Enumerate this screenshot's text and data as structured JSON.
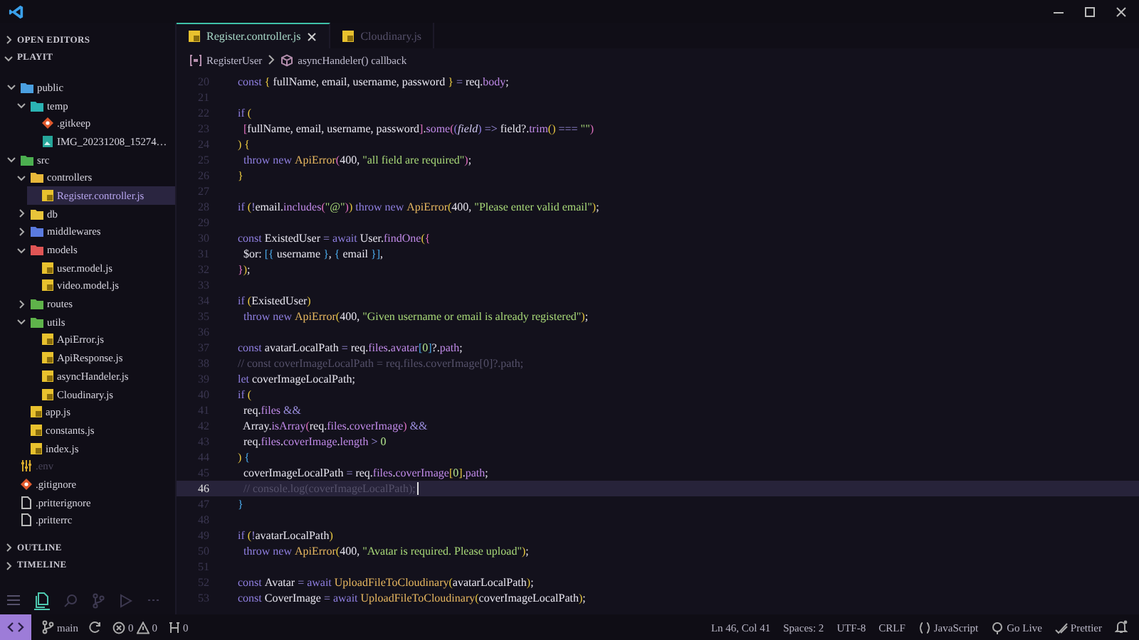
{
  "sidebar": {
    "sections": [
      {
        "label": "OPEN EDITORS",
        "expanded": false
      },
      {
        "label": "PLAYIT",
        "expanded": true
      }
    ],
    "tree": [
      {
        "label": "public",
        "kind": "folder",
        "color": "#4a9fe0",
        "expanded": true,
        "selected": false,
        "children": [
          {
            "label": "temp",
            "kind": "folder",
            "color": "#2bb3b3",
            "expanded": true,
            "selected": false,
            "children": [
              {
                "label": ".gitkeep",
                "kind": "git",
                "selected": false
              },
              {
                "label": "IMG_20231208_15274…",
                "kind": "image",
                "selected": false
              }
            ]
          }
        ]
      },
      {
        "label": "src",
        "kind": "folder",
        "color": "#4caf50",
        "expanded": true,
        "selected": false,
        "children": [
          {
            "label": "controllers",
            "kind": "folder",
            "color": "#e8b83a",
            "expanded": true,
            "selected": false,
            "children": [
              {
                "label": "Register.controller.js",
                "kind": "js",
                "selected": true
              }
            ]
          },
          {
            "label": "db",
            "kind": "folder",
            "color": "#e8c43a",
            "expanded": false,
            "selected": false
          },
          {
            "label": "middlewares",
            "kind": "folder",
            "color": "#5b7be0",
            "expanded": false,
            "selected": false
          },
          {
            "label": "models",
            "kind": "folder",
            "color": "#e05555",
            "expanded": true,
            "selected": false,
            "children": [
              {
                "label": "user.model.js",
                "kind": "js",
                "selected": false
              },
              {
                "label": "video.model.js",
                "kind": "js",
                "selected": false
              }
            ]
          },
          {
            "label": "routes",
            "kind": "folder",
            "color": "#5fb34a",
            "expanded": false,
            "selected": false
          },
          {
            "label": "utils",
            "kind": "folder",
            "color": "#5fb34b",
            "expanded": true,
            "selected": false,
            "children": [
              {
                "label": "ApiError.js",
                "kind": "js",
                "selected": false
              },
              {
                "label": "ApiResponse.js",
                "kind": "js",
                "selected": false
              },
              {
                "label": "asyncHandeler.js",
                "kind": "js",
                "selected": false
              },
              {
                "label": "Cloudinary.js",
                "kind": "js",
                "selected": false
              }
            ]
          },
          {
            "label": "app.js",
            "kind": "js",
            "selected": false
          },
          {
            "label": "constants.js",
            "kind": "js",
            "selected": false
          },
          {
            "label": "index.js",
            "kind": "js",
            "selected": false
          }
        ]
      },
      {
        "label": ".env",
        "kind": "env",
        "selected": false
      },
      {
        "label": ".gitignore",
        "kind": "git",
        "selected": false
      },
      {
        "label": ".pritterignore",
        "kind": "text",
        "selected": false
      },
      {
        "label": ".pritterrc",
        "kind": "text",
        "selected": false
      }
    ],
    "panels": [
      {
        "label": "OUTLINE",
        "expanded": false
      },
      {
        "label": "TIMELINE",
        "expanded": false
      }
    ]
  },
  "tabs": [
    {
      "label": "Register.controller.js",
      "selected": true
    },
    {
      "label": "Cloudinary.js",
      "selected": false
    }
  ],
  "breadcrumb": [
    {
      "label": "RegisterUser",
      "kind": "variable"
    },
    {
      "label": "asyncHandeler() callback",
      "kind": "function"
    }
  ],
  "editor": {
    "lines": [
      {
        "n": "20",
        "current": false,
        "segs": [
          {
            "kind": "kw",
            "text": "const "
          },
          {
            "kind": "br",
            "text": "{ "
          },
          {
            "kind": "id",
            "text": "fullName, email, username, password "
          },
          {
            "kind": "br",
            "text": "}"
          },
          {
            "kind": "op",
            "text": " = "
          },
          {
            "kind": "id",
            "text": "req."
          },
          {
            "kind": "prop",
            "text": "body"
          },
          {
            "kind": "id",
            "text": ";"
          }
        ]
      },
      {
        "n": "21",
        "current": false
      },
      {
        "n": "22",
        "current": false,
        "segs": [
          {
            "kind": "kw",
            "text": "if "
          },
          {
            "kind": "br",
            "text": "("
          }
        ]
      },
      {
        "n": "23",
        "current": false,
        "segs": [
          {
            "kind": "br2",
            "text": "  ["
          },
          {
            "kind": "id",
            "text": "fullName, email, username, password"
          },
          {
            "kind": "br2",
            "text": "]"
          },
          {
            "kind": "id",
            "text": "."
          },
          {
            "kind": "prop",
            "text": "some"
          },
          {
            "kind": "br2",
            "text": "("
          },
          {
            "kind": "kw",
            "text": "("
          },
          {
            "kind": "ital",
            "text": "field"
          },
          {
            "kind": "kw",
            "text": ")"
          },
          {
            "kind": "op",
            "text": " => "
          },
          {
            "kind": "id",
            "text": "field?."
          },
          {
            "kind": "prop",
            "text": "trim"
          },
          {
            "kind": "br",
            "text": "()"
          },
          {
            "kind": "op",
            "text": " === "
          },
          {
            "kind": "str",
            "text": "\"\""
          },
          {
            "kind": "br2",
            "text": ")"
          }
        ]
      },
      {
        "n": "24",
        "current": false,
        "segs": [
          {
            "kind": "br",
            "text": ") {"
          }
        ]
      },
      {
        "n": "25",
        "current": false,
        "segs": [
          {
            "kind": "kw",
            "text": "  throw new "
          },
          {
            "kind": "fn",
            "text": "ApiError"
          },
          {
            "kind": "br2",
            "text": "("
          },
          {
            "kind": "id",
            "text": "400, "
          },
          {
            "kind": "str",
            "text": "\"all field are required\""
          },
          {
            "kind": "br2",
            "text": ")"
          },
          {
            "kind": "id",
            "text": ";"
          }
        ]
      },
      {
        "n": "26",
        "current": false,
        "segs": [
          {
            "kind": "br",
            "text": "}"
          }
        ]
      },
      {
        "n": "27",
        "current": false
      },
      {
        "n": "28",
        "current": false,
        "segs": [
          {
            "kind": "kw",
            "text": "if "
          },
          {
            "kind": "br",
            "text": "("
          },
          {
            "kind": "op",
            "text": "!"
          },
          {
            "kind": "id",
            "text": "email."
          },
          {
            "kind": "prop",
            "text": "includes"
          },
          {
            "kind": "br2",
            "text": "("
          },
          {
            "kind": "str",
            "text": "\"@\""
          },
          {
            "kind": "br2",
            "text": ")"
          },
          {
            "kind": "br",
            "text": ")"
          },
          {
            "kind": "kw",
            "text": " throw new "
          },
          {
            "kind": "fn",
            "text": "ApiError"
          },
          {
            "kind": "br",
            "text": "("
          },
          {
            "kind": "id",
            "text": "400, "
          },
          {
            "kind": "str",
            "text": "\"Please enter valid email\""
          },
          {
            "kind": "br",
            "text": ")"
          },
          {
            "kind": "id",
            "text": ";"
          }
        ]
      },
      {
        "n": "29",
        "current": false
      },
      {
        "n": "30",
        "current": false,
        "segs": [
          {
            "kind": "kw",
            "text": "const "
          },
          {
            "kind": "id",
            "text": "ExistedUser "
          },
          {
            "kind": "op",
            "text": "= "
          },
          {
            "kind": "kw",
            "text": "await "
          },
          {
            "kind": "id",
            "text": "User."
          },
          {
            "kind": "prop",
            "text": "findOne"
          },
          {
            "kind": "br",
            "text": "("
          },
          {
            "kind": "br2",
            "text": "{"
          }
        ]
      },
      {
        "n": "31",
        "current": false,
        "segs": [
          {
            "kind": "id",
            "text": "  $or: "
          },
          {
            "kind": "br3",
            "text": "[{ "
          },
          {
            "kind": "id",
            "text": "username "
          },
          {
            "kind": "br3",
            "text": "}"
          },
          {
            "kind": "id",
            "text": ", "
          },
          {
            "kind": "br3",
            "text": "{ "
          },
          {
            "kind": "id",
            "text": "email "
          },
          {
            "kind": "br3",
            "text": "}]"
          },
          {
            "kind": "id",
            "text": ","
          }
        ]
      },
      {
        "n": "32",
        "current": false,
        "segs": [
          {
            "kind": "br2",
            "text": "}"
          },
          {
            "kind": "br",
            "text": ")"
          },
          {
            "kind": "id",
            "text": ";"
          }
        ]
      },
      {
        "n": "33",
        "current": false
      },
      {
        "n": "34",
        "current": false,
        "segs": [
          {
            "kind": "kw",
            "text": "if "
          },
          {
            "kind": "br",
            "text": "("
          },
          {
            "kind": "id",
            "text": "ExistedUser"
          },
          {
            "kind": "br",
            "text": ")"
          }
        ]
      },
      {
        "n": "35",
        "current": false,
        "segs": [
          {
            "kind": "kw",
            "text": "  throw new "
          },
          {
            "kind": "fn",
            "text": "ApiError"
          },
          {
            "kind": "br",
            "text": "("
          },
          {
            "kind": "id",
            "text": "400, "
          },
          {
            "kind": "str",
            "text": "\"Given username or email is already registered\""
          },
          {
            "kind": "br",
            "text": ")"
          },
          {
            "kind": "id",
            "text": ";"
          }
        ]
      },
      {
        "n": "36",
        "current": false
      },
      {
        "n": "37",
        "current": false,
        "segs": [
          {
            "kind": "kw",
            "text": "const "
          },
          {
            "kind": "id",
            "text": "avatarLocalPath "
          },
          {
            "kind": "op",
            "text": "= "
          },
          {
            "kind": "id",
            "text": "req."
          },
          {
            "kind": "prop",
            "text": "files"
          },
          {
            "kind": "id",
            "text": "."
          },
          {
            "kind": "prop",
            "text": "avatar"
          },
          {
            "kind": "br3",
            "text": "["
          },
          {
            "kind": "num",
            "text": "0"
          },
          {
            "kind": "br3",
            "text": "]"
          },
          {
            "kind": "id",
            "text": "?."
          },
          {
            "kind": "prop",
            "text": "path"
          },
          {
            "kind": "id",
            "text": ";"
          }
        ]
      },
      {
        "n": "38",
        "current": false,
        "segs": [
          {
            "kind": "cmt",
            "text": "// const coverImageLocalPath = req.files.coverImage[0]?.path;"
          }
        ]
      },
      {
        "n": "39",
        "current": false,
        "segs": [
          {
            "kind": "kw",
            "text": "let "
          },
          {
            "kind": "id",
            "text": "coverImageLocalPath;"
          }
        ]
      },
      {
        "n": "40",
        "current": false,
        "segs": [
          {
            "kind": "kw",
            "text": "if "
          },
          {
            "kind": "br",
            "text": "("
          }
        ]
      },
      {
        "n": "41",
        "current": false,
        "segs": [
          {
            "kind": "id",
            "text": "  req."
          },
          {
            "kind": "prop",
            "text": "files"
          },
          {
            "kind": "op",
            "text": " &&"
          }
        ]
      },
      {
        "n": "42",
        "current": false,
        "segs": [
          {
            "kind": "id",
            "text": "  Array."
          },
          {
            "kind": "prop",
            "text": "isArray"
          },
          {
            "kind": "br2",
            "text": "("
          },
          {
            "kind": "id",
            "text": "req."
          },
          {
            "kind": "prop",
            "text": "files"
          },
          {
            "kind": "id",
            "text": "."
          },
          {
            "kind": "prop",
            "text": "coverImage"
          },
          {
            "kind": "br2",
            "text": ")"
          },
          {
            "kind": "op",
            "text": " &&"
          }
        ]
      },
      {
        "n": "43",
        "current": false,
        "segs": [
          {
            "kind": "id",
            "text": "  req."
          },
          {
            "kind": "prop",
            "text": "files"
          },
          {
            "kind": "id",
            "text": "."
          },
          {
            "kind": "prop",
            "text": "coverImage"
          },
          {
            "kind": "id",
            "text": "."
          },
          {
            "kind": "prop",
            "text": "length"
          },
          {
            "kind": "op",
            "text": " > "
          },
          {
            "kind": "num",
            "text": "0"
          }
        ]
      },
      {
        "n": "44",
        "current": false,
        "segs": [
          {
            "kind": "br",
            "text": ") "
          },
          {
            "kind": "br3",
            "text": "{"
          }
        ]
      },
      {
        "n": "45",
        "current": false,
        "segs": [
          {
            "kind": "id",
            "text": "  coverImageLocalPath "
          },
          {
            "kind": "op",
            "text": "= "
          },
          {
            "kind": "id",
            "text": "req."
          },
          {
            "kind": "prop",
            "text": "files"
          },
          {
            "kind": "id",
            "text": "."
          },
          {
            "kind": "prop",
            "text": "coverImage"
          },
          {
            "kind": "br",
            "text": "["
          },
          {
            "kind": "num",
            "text": "0"
          },
          {
            "kind": "br",
            "text": "]"
          },
          {
            "kind": "id",
            "text": "."
          },
          {
            "kind": "prop",
            "text": "path"
          },
          {
            "kind": "id",
            "text": ";"
          }
        ]
      },
      {
        "n": "46",
        "current": true,
        "segs": [
          {
            "kind": "cmt",
            "text": "  // console.log(coverImageLocalPath);"
          }
        ]
      },
      {
        "n": "47",
        "current": false,
        "segs": [
          {
            "kind": "br3",
            "text": "}"
          }
        ]
      },
      {
        "n": "48",
        "current": false
      },
      {
        "n": "49",
        "current": false,
        "segs": [
          {
            "kind": "kw",
            "text": "if "
          },
          {
            "kind": "br",
            "text": "("
          },
          {
            "kind": "op",
            "text": "!"
          },
          {
            "kind": "id",
            "text": "avatarLocalPath"
          },
          {
            "kind": "br",
            "text": ")"
          }
        ]
      },
      {
        "n": "50",
        "current": false,
        "segs": [
          {
            "kind": "kw",
            "text": "  throw new "
          },
          {
            "kind": "fn",
            "text": "ApiError"
          },
          {
            "kind": "br",
            "text": "("
          },
          {
            "kind": "id",
            "text": "400, "
          },
          {
            "kind": "str",
            "text": "\"Avatar is required. Please upload\""
          },
          {
            "kind": "br",
            "text": ")"
          },
          {
            "kind": "id",
            "text": ";"
          }
        ]
      },
      {
        "n": "51",
        "current": false
      },
      {
        "n": "52",
        "current": false,
        "segs": [
          {
            "kind": "kw",
            "text": "const "
          },
          {
            "kind": "id",
            "text": "Avatar "
          },
          {
            "kind": "op",
            "text": "= "
          },
          {
            "kind": "kw",
            "text": "await "
          },
          {
            "kind": "fn",
            "text": "UploadFileToCloudinary"
          },
          {
            "kind": "br",
            "text": "("
          },
          {
            "kind": "id",
            "text": "avatarLocalPath"
          },
          {
            "kind": "br",
            "text": ")"
          },
          {
            "kind": "id",
            "text": ";"
          }
        ]
      },
      {
        "n": "53",
        "current": false,
        "segs": [
          {
            "kind": "kw",
            "text": "const "
          },
          {
            "kind": "id",
            "text": "CoverImage "
          },
          {
            "kind": "op",
            "text": "= "
          },
          {
            "kind": "kw",
            "text": "await "
          },
          {
            "kind": "fn",
            "text": "UploadFileToCloudinary"
          },
          {
            "kind": "br",
            "text": "("
          },
          {
            "kind": "id",
            "text": "coverImageLocalPath"
          },
          {
            "kind": "br",
            "text": ")"
          },
          {
            "kind": "id",
            "text": ";"
          }
        ]
      }
    ]
  },
  "status_bar": {
    "branch": "main",
    "errors": "0",
    "warnings": "0",
    "ports": "0",
    "right": [
      {
        "label": "Ln 46, Col 41",
        "kind": "plain"
      },
      {
        "label": "Spaces: 2",
        "kind": "plain"
      },
      {
        "label": "UTF-8",
        "kind": "plain"
      },
      {
        "label": "CRLF",
        "kind": "plain"
      },
      {
        "label": "JavaScript",
        "kind": "language"
      },
      {
        "label": "Go Live",
        "kind": "live"
      },
      {
        "label": "Prettier",
        "kind": "prettier"
      }
    ]
  }
}
